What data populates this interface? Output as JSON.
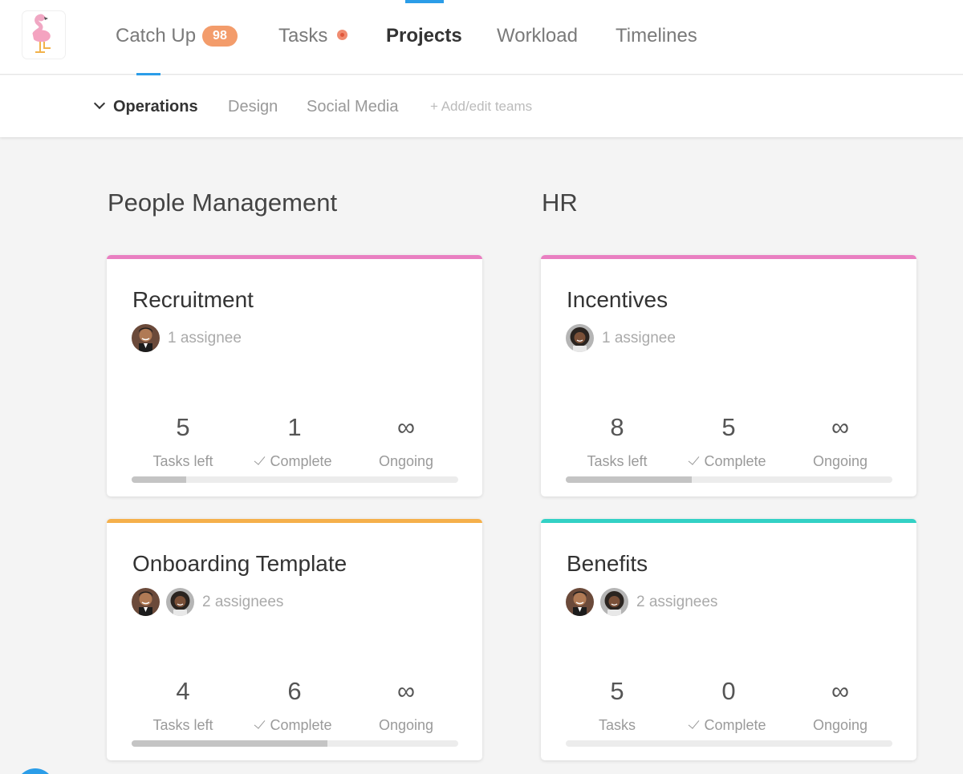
{
  "nav": {
    "tabs": [
      {
        "label": "Catch Up",
        "badge": "98"
      },
      {
        "label": "Tasks"
      },
      {
        "label": "Projects"
      },
      {
        "label": "Workload"
      },
      {
        "label": "Timelines"
      }
    ],
    "active": "Projects"
  },
  "teams": {
    "items": [
      "Operations",
      "Design",
      "Social Media"
    ],
    "active": "Operations",
    "add_label": "+ Add/edit teams"
  },
  "sections": [
    {
      "title": "People Management",
      "projects": [
        {
          "title": "Recruitment",
          "color": "#e97fc1",
          "assignee_text": "1 assignee",
          "stats": [
            {
              "value": "5",
              "label": "Tasks left"
            },
            {
              "value": "1",
              "label": "Complete"
            },
            {
              "value": "∞",
              "label": "Ongoing"
            }
          ],
          "progress": 0.167
        },
        {
          "title": "Onboarding Template",
          "color": "#f5b04b",
          "assignee_text": "2 assignees",
          "stats": [
            {
              "value": "4",
              "label": "Tasks left"
            },
            {
              "value": "6",
              "label": "Complete"
            },
            {
              "value": "∞",
              "label": "Ongoing"
            }
          ],
          "progress": 0.6
        }
      ]
    },
    {
      "title": "HR",
      "projects": [
        {
          "title": "Incentives",
          "color": "#e97fc1",
          "assignee_text": "1 assignee",
          "stats": [
            {
              "value": "8",
              "label": "Tasks left"
            },
            {
              "value": "5",
              "label": "Complete"
            },
            {
              "value": "∞",
              "label": "Ongoing"
            }
          ],
          "progress": 0.385
        },
        {
          "title": "Benefits",
          "color": "#33d1c5",
          "assignee_text": "2 assignees",
          "stats": [
            {
              "value": "5",
              "label": "Tasks"
            },
            {
              "value": "0",
              "label": "Complete"
            },
            {
              "value": "∞",
              "label": "Ongoing"
            }
          ],
          "progress": 0
        }
      ]
    }
  ]
}
